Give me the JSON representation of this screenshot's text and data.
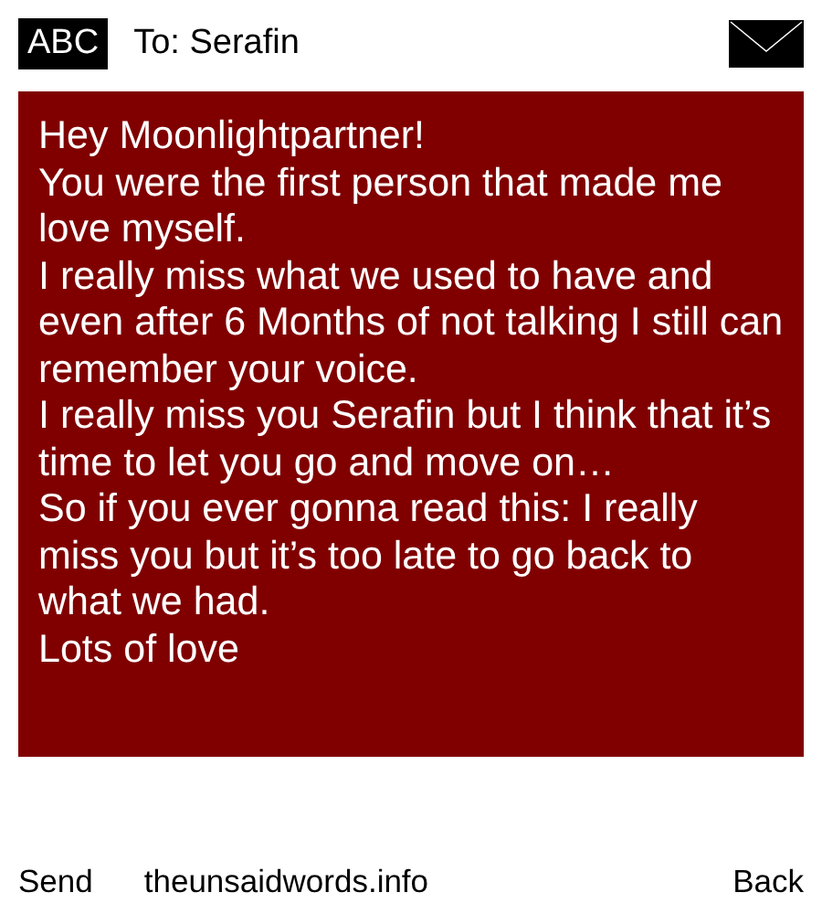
{
  "header": {
    "badge": "ABC",
    "recipient": "To: Serafin"
  },
  "message": {
    "paragraphs": [
      "Hey Moonlightpartner!",
      "You were the first person that made me love myself.",
      "I really miss what we used to have and even after 6 Months of not talking I still can remember your voice.",
      "I really miss you Serafin but I think that it’s time to let you go and move on…",
      "So if you ever gonna read this: I really miss you but it’s too late to go back to what we had.",
      "Lots of love"
    ]
  },
  "footer": {
    "send": "Send",
    "site": "theunsaidwords.info",
    "back": "Back"
  }
}
